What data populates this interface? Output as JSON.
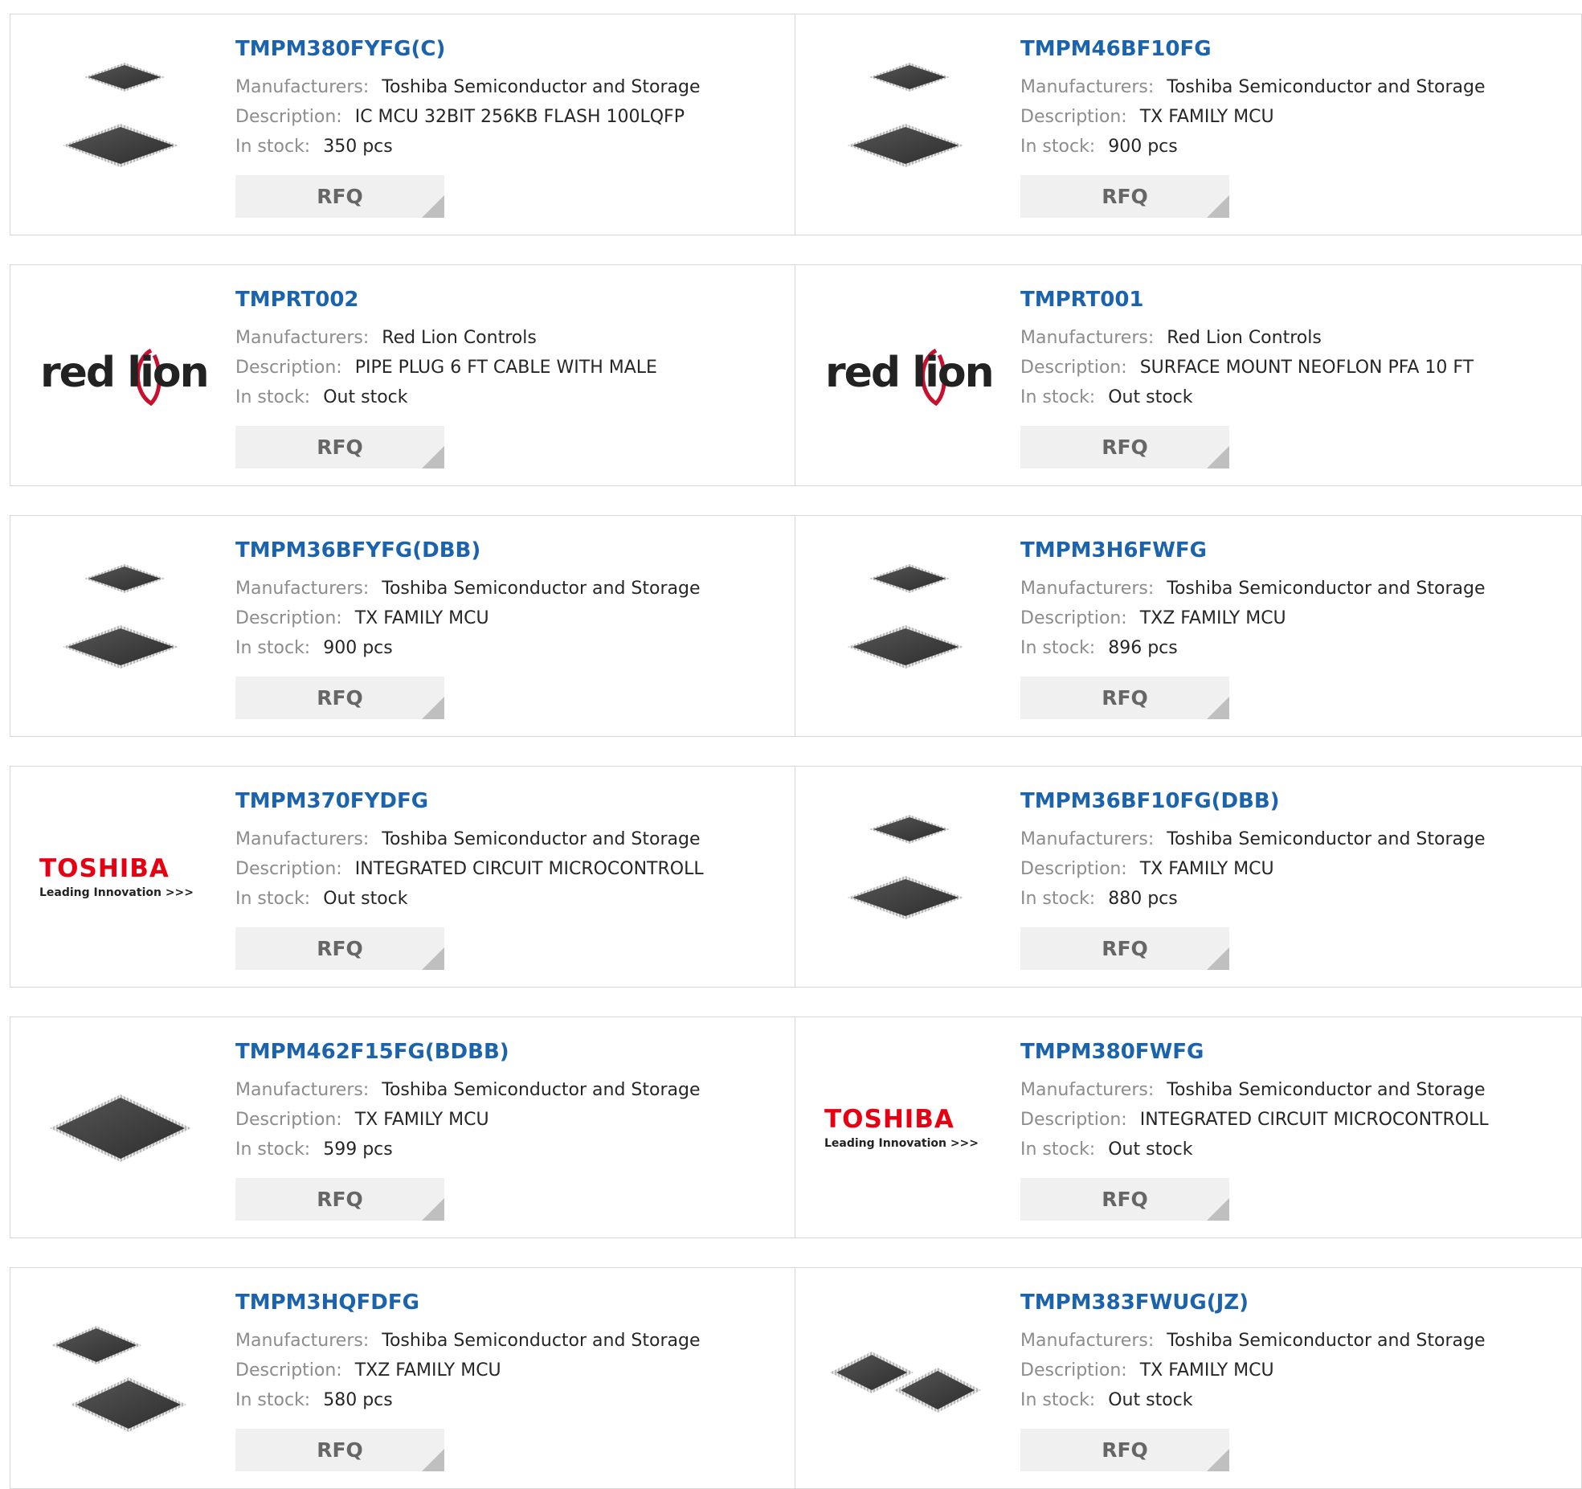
{
  "labels": {
    "manufacturers": "Manufacturers:",
    "description": "Description:",
    "in_stock": "In stock:",
    "rfq": "RFQ"
  },
  "colors": {
    "part_link": "#1b63ad",
    "key_text": "#8c8c8c",
    "value_text": "#262626",
    "rfq_bg": "#f0f0f0",
    "toshiba_red": "#e60012"
  },
  "products": [
    {
      "part": "TMPM380FYFG(C)",
      "manufacturer": "Toshiba Semiconductor and Storage",
      "description": "IC MCU 32BIT 256KB FLASH 100LQFP",
      "stock": "350 pcs",
      "image": "chip-pair-icon"
    },
    {
      "part": "TMPM46BF10FG",
      "manufacturer": "Toshiba Semiconductor and Storage",
      "description": "TX FAMILY MCU",
      "stock": "900 pcs",
      "image": "chip-pair-icon"
    },
    {
      "part": "TMPRT002",
      "manufacturer": "Red Lion Controls",
      "description": "PIPE PLUG 6 FT CABLE WITH MALE",
      "stock": "Out stock",
      "image": "red-lion-logo",
      "logo_text": "red lion"
    },
    {
      "part": "TMPRT001",
      "manufacturer": "Red Lion Controls",
      "description": "SURFACE MOUNT NEOFLON PFA 10 FT",
      "stock": "Out stock",
      "image": "red-lion-logo",
      "logo_text": "red lion"
    },
    {
      "part": "TMPM36BFYFG(DBB)",
      "manufacturer": "Toshiba Semiconductor and Storage",
      "description": "TX FAMILY MCU",
      "stock": "900 pcs",
      "image": "chip-pair-icon"
    },
    {
      "part": "TMPM3H6FWFG",
      "manufacturer": "Toshiba Semiconductor and Storage",
      "description": "TXZ FAMILY MCU",
      "stock": "896 pcs",
      "image": "chip-pair-icon"
    },
    {
      "part": "TMPM370FYDFG",
      "manufacturer": "Toshiba Semiconductor and Storage",
      "description": "INTEGRATED CIRCUIT MICROCONTROLL",
      "stock": "Out stock",
      "image": "toshiba-logo",
      "logo_text": "TOSHIBA",
      "logo_tagline": "Leading Innovation >>>"
    },
    {
      "part": "TMPM36BF10FG(DBB)",
      "manufacturer": "Toshiba Semiconductor and Storage",
      "description": "TX FAMILY MCU",
      "stock": "880 pcs",
      "image": "chip-pair-icon"
    },
    {
      "part": "TMPM462F15FG(BDBB)",
      "manufacturer": "Toshiba Semiconductor and Storage",
      "description": "TX FAMILY MCU",
      "stock": "599 pcs",
      "image": "chip-large-icon"
    },
    {
      "part": "TMPM380FWFG",
      "manufacturer": "Toshiba Semiconductor and Storage",
      "description": "INTEGRATED CIRCUIT MICROCONTROLL",
      "stock": "Out stock",
      "image": "toshiba-logo",
      "logo_text": "TOSHIBA",
      "logo_tagline": "Leading Innovation >>>"
    },
    {
      "part": "TMPM3HQFDFG",
      "manufacturer": "Toshiba Semiconductor and Storage",
      "description": "TXZ FAMILY MCU",
      "stock": "580 pcs",
      "image": "chip-pair-icon"
    },
    {
      "part": "TMPM383FWUG(JZ)",
      "manufacturer": "Toshiba Semiconductor and Storage",
      "description": "TX FAMILY MCU",
      "stock": "Out stock",
      "image": "chip-side-icon"
    }
  ]
}
